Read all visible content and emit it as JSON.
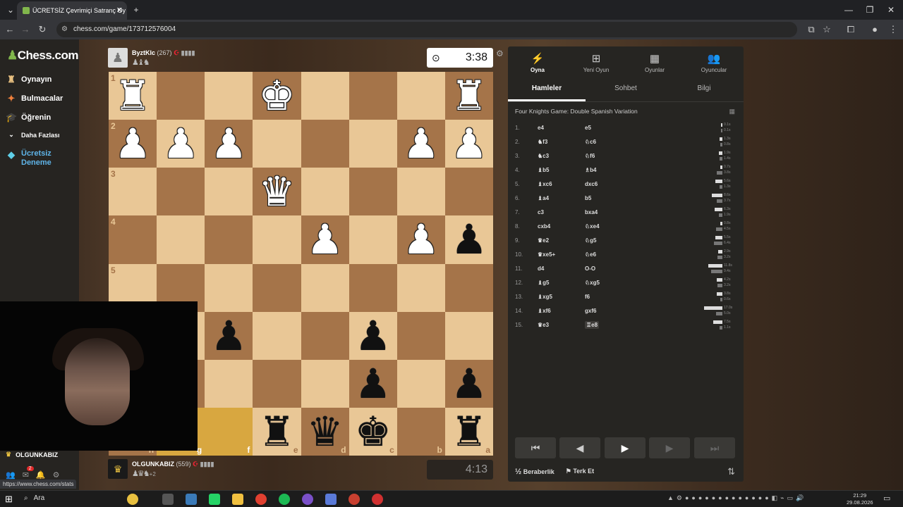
{
  "browser": {
    "tab_title": "ÜCRETSİZ Çevrimiçi Satranç Oy",
    "tab_close": "✕",
    "new_tab": "+",
    "url": "chess.com/game/173712576004",
    "window_controls": [
      "—",
      "❐",
      "✕"
    ]
  },
  "sidebar": {
    "logo": "Chess.com",
    "items": [
      {
        "label": "Oynayın",
        "icon": "play-icon"
      },
      {
        "label": "Bulmacalar",
        "icon": "puzzle-icon"
      },
      {
        "label": "Öğrenin",
        "icon": "learn-icon"
      },
      {
        "label": "Daha Fazlası",
        "icon": "chevron-down-icon"
      },
      {
        "label": "Ücretsiz Deneme",
        "icon": "diamond-icon"
      }
    ],
    "user": "OLGUNKABIZ",
    "notif_count": "2",
    "status_url": "https://www.chess.com/stats"
  },
  "players": {
    "top": {
      "name": "ByztKlc",
      "rating": "(267)",
      "clock": "3:38",
      "captured": "♟♝♞"
    },
    "bottom": {
      "name": "OLGUNKABIZ",
      "rating": "(559)",
      "clock": "4:13",
      "captured": "♟♛♞",
      "plus": "+2"
    }
  },
  "board": {
    "ranks": [
      "1",
      "2",
      "3",
      "4",
      "5",
      "6",
      "7",
      "8"
    ],
    "files": [
      "h",
      "g",
      "f",
      "e",
      "d",
      "c",
      "b",
      "a"
    ],
    "squares": [
      [
        "wR",
        "",
        "",
        "wK",
        "",
        "",
        "",
        "wR"
      ],
      [
        "wP",
        "wP",
        "wP",
        "",
        "",
        "",
        "wP",
        "wP"
      ],
      [
        "",
        "",
        "",
        "wQ",
        "",
        "",
        "",
        ""
      ],
      [
        "",
        "",
        "",
        "",
        "wP",
        "",
        "wP",
        "bP"
      ],
      [
        "",
        "",
        "",
        "",
        "",
        "",
        "",
        ""
      ],
      [
        "",
        "",
        "bP",
        "",
        "",
        "bP",
        "",
        ""
      ],
      [
        "",
        "",
        "",
        "",
        "",
        "bP",
        "",
        "bP"
      ],
      [
        "",
        "",
        "",
        "bR",
        "bQ",
        "bK",
        "",
        "bR"
      ]
    ]
  },
  "panel": {
    "top_buttons": [
      {
        "label": "Oyna",
        "icon": "⚡"
      },
      {
        "label": "Yeni Oyun",
        "icon": "⊞"
      },
      {
        "label": "Oyunlar",
        "icon": "▦"
      },
      {
        "label": "Oyuncular",
        "icon": "👥"
      }
    ],
    "tabs": [
      "Hamleler",
      "Sohbet",
      "Bilgi"
    ],
    "opening": "Four Knights Game: Double Spanish Variation",
    "moves": [
      {
        "n": "1.",
        "w": "e4",
        "b": "e5",
        "tw": "0.1s",
        "tb": "0.1s"
      },
      {
        "n": "2.",
        "w": "♞f3",
        "b": "♘c6",
        "tw": "1.3s",
        "tb": "0.8s"
      },
      {
        "n": "3.",
        "w": "♞c3",
        "b": "♘f6",
        "tw": "1.9s",
        "tb": "1.4s"
      },
      {
        "n": "4.",
        "w": "♝b5",
        "b": "♗b4",
        "tw": "0.7s",
        "tb": "3.8s"
      },
      {
        "n": "5.",
        "w": "♝xc6",
        "b": "dxc6",
        "tw": "5.6s",
        "tb": "1.3s"
      },
      {
        "n": "6.",
        "w": "♝a4",
        "b": "b5",
        "tw": "8.6s",
        "tb": "3.7s"
      },
      {
        "n": "7.",
        "w": "c3",
        "b": "bxa4",
        "tw": "6.3s",
        "tb": "1.9s"
      },
      {
        "n": "8.",
        "w": "cxb4",
        "b": "♘xe4",
        "tw": "0.8s",
        "tb": "4.5s"
      },
      {
        "n": "9.",
        "w": "♛e2",
        "b": "♘g5",
        "tw": "5.5s",
        "tb": "6.4s"
      },
      {
        "n": "10.",
        "w": "♛xe5+",
        "b": "♘e6",
        "tw": "2.9s",
        "tb": "3.2s"
      },
      {
        "n": "11.",
        "w": "d4",
        "b": "O-O",
        "tw": "11.8s",
        "tb": "9.4s"
      },
      {
        "n": "12.",
        "w": "♝g5",
        "b": "♘xg5",
        "tw": "4.2s",
        "tb": "3.2s"
      },
      {
        "n": "13.",
        "w": "♝xg5",
        "b": "f6",
        "tw": "3.8s",
        "tb": "0.6s"
      },
      {
        "n": "14.",
        "w": "♝xf6",
        "b": "gxf6",
        "tw": "17.0s",
        "tb": "5.0s"
      },
      {
        "n": "15.",
        "w": "♛e3",
        "b": "♖e8",
        "tw": "7.5s",
        "tb": "1.1s"
      }
    ],
    "nav": [
      "⏮",
      "◀",
      "▶",
      "▶",
      "⏭"
    ],
    "draw": "Beraberlik",
    "resign": "Terk Et",
    "draw_icon": "½"
  },
  "taskbar": {
    "search": "Ara",
    "time": "21:29",
    "date": "29.08.2026"
  }
}
